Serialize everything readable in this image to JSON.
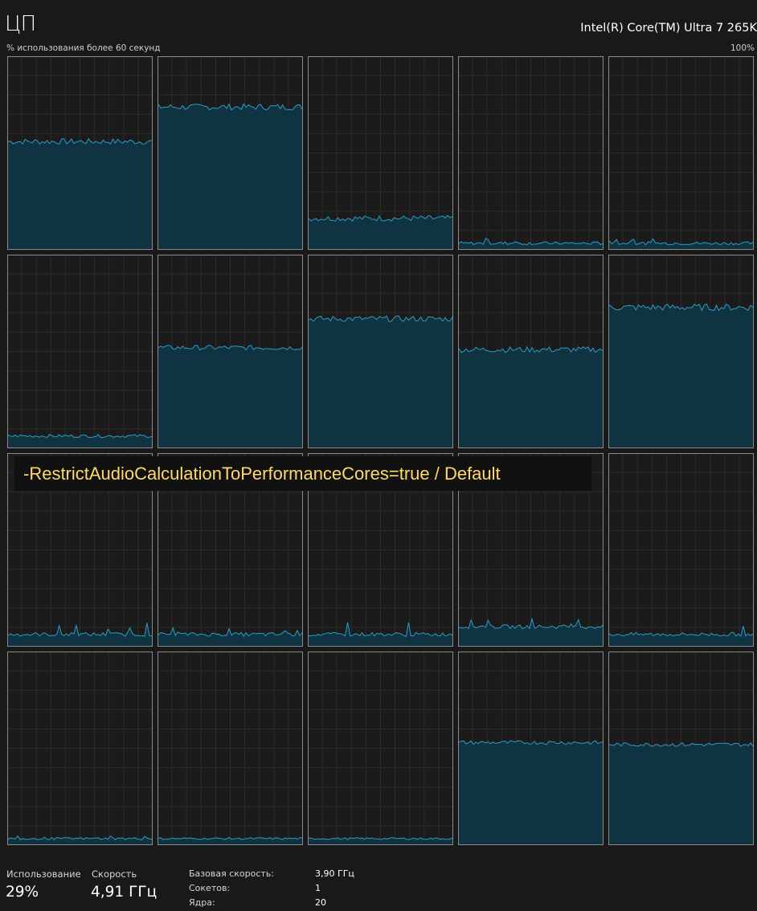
{
  "header": {
    "title": "ЦП",
    "cpu_name": "Intel(R) Core(TM) Ultra 7 265K",
    "subtitle": "% использования более 60 секунд",
    "max_percent": "100%"
  },
  "overlay": {
    "text": "-RestrictAudioCalculationToPerformanceCores=true / Default"
  },
  "colors": {
    "background": "#191919",
    "grid_line": "#2c2c2c",
    "cell_border": "#8a8a8a",
    "line": "#2f9bc6",
    "fill": "#0f3340",
    "overlay_text": "#ffd966"
  },
  "chart_data": {
    "type": "area",
    "y_range": [
      0,
      100
    ],
    "cores": [
      {
        "level": 56,
        "noise": 1.5,
        "spike": 0
      },
      {
        "level": 74,
        "noise": 1.6,
        "spike": 0
      },
      {
        "level": 16,
        "noise": 1.5,
        "spike": 0
      },
      {
        "level": 3,
        "noise": 0.8,
        "spike": 2
      },
      {
        "level": 3,
        "noise": 0.8,
        "spike": 2
      },
      {
        "level": 6,
        "noise": 0.8,
        "spike": 0
      },
      {
        "level": 52,
        "noise": 1.3,
        "spike": 0
      },
      {
        "level": 67,
        "noise": 1.5,
        "spike": 0
      },
      {
        "level": 51,
        "noise": 1.5,
        "spike": 0
      },
      {
        "level": 73,
        "noise": 1.8,
        "spike": 0
      },
      {
        "level": 6,
        "noise": 1.0,
        "spike": 4
      },
      {
        "level": 6,
        "noise": 1.0,
        "spike": 3
      },
      {
        "level": 6,
        "noise": 1.0,
        "spike": 5
      },
      {
        "level": 10,
        "noise": 1.0,
        "spike": 3
      },
      {
        "level": 6,
        "noise": 1.0,
        "spike": 3
      },
      {
        "level": 3,
        "noise": 0.6,
        "spike": 1
      },
      {
        "level": 3,
        "noise": 0.5,
        "spike": 0
      },
      {
        "level": 3,
        "noise": 0.5,
        "spike": 0
      },
      {
        "level": 53,
        "noise": 1.0,
        "spike": 0
      },
      {
        "level": 52,
        "noise": 1.0,
        "spike": 0
      }
    ]
  },
  "stats": {
    "usage_label": "Использование",
    "usage_value": "29%",
    "speed_label": "Скорость",
    "speed_value": "4,91 ГГц"
  },
  "details": {
    "base_speed_label": "Базовая скорость:",
    "base_speed_value": "3,90 ГГц",
    "sockets_label": "Сокетов:",
    "sockets_value": "1",
    "cores_label": "Ядра:",
    "cores_value": "20"
  }
}
